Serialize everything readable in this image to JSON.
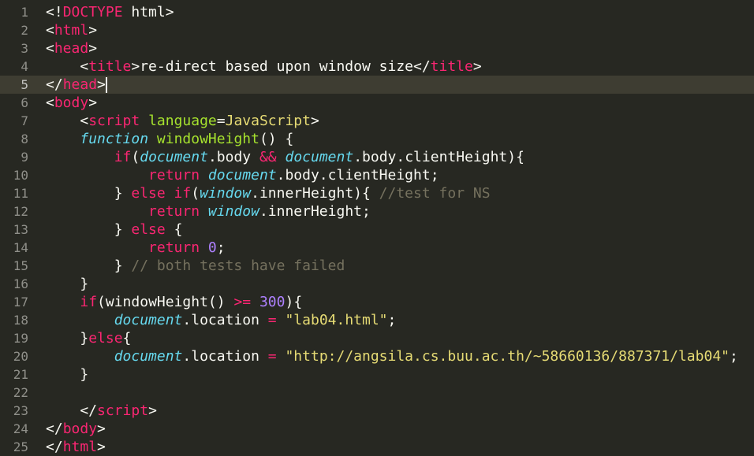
{
  "editor": {
    "theme": {
      "background": "#272822",
      "active_line": "#3e3d32",
      "tag": "#f92672",
      "attr": "#a6e22e",
      "string": "#e6db74",
      "support": "#66d9ef",
      "number": "#ae81ff",
      "comment": "#75715e"
    },
    "active_line_number": "5",
    "lines": [
      {
        "n": "1",
        "tokens": [
          [
            "t",
            "<!"
          ],
          [
            "tag",
            "DOCTYPE"
          ],
          [
            "t",
            " html>"
          ]
        ]
      },
      {
        "n": "2",
        "tokens": [
          [
            "t",
            "<"
          ],
          [
            "tag",
            "html"
          ],
          [
            "t",
            ">"
          ]
        ]
      },
      {
        "n": "3",
        "tokens": [
          [
            "t",
            "<"
          ],
          [
            "tag",
            "head"
          ],
          [
            "t",
            ">"
          ]
        ]
      },
      {
        "n": "4",
        "tokens": [
          [
            "t",
            "    <"
          ],
          [
            "tag",
            "title"
          ],
          [
            "t",
            ">re-direct based upon window size</"
          ],
          [
            "tag",
            "title"
          ],
          [
            "t",
            ">"
          ]
        ]
      },
      {
        "n": "5",
        "tokens": [
          [
            "t",
            "</"
          ],
          [
            "tag",
            "head"
          ],
          [
            "t",
            ">"
          ]
        ]
      },
      {
        "n": "6",
        "tokens": [
          [
            "t",
            "<"
          ],
          [
            "tag",
            "body"
          ],
          [
            "t",
            ">"
          ]
        ]
      },
      {
        "n": "7",
        "tokens": [
          [
            "t",
            "    <"
          ],
          [
            "tag",
            "script"
          ],
          [
            "t",
            " "
          ],
          [
            "attr",
            "language"
          ],
          [
            "t",
            "="
          ],
          [
            "str",
            "JavaScript"
          ],
          [
            "t",
            ">"
          ]
        ]
      },
      {
        "n": "8",
        "tokens": [
          [
            "t",
            "    "
          ],
          [
            "sf",
            "function"
          ],
          [
            "t",
            " "
          ],
          [
            "fn",
            "windowHeight"
          ],
          [
            "t",
            "() {"
          ]
        ]
      },
      {
        "n": "9",
        "tokens": [
          [
            "t",
            "        "
          ],
          [
            "kw",
            "if"
          ],
          [
            "t",
            "("
          ],
          [
            "sf",
            "document"
          ],
          [
            "t",
            ".body "
          ],
          [
            "op",
            "&&"
          ],
          [
            "t",
            " "
          ],
          [
            "sf",
            "document"
          ],
          [
            "t",
            ".body.clientHeight){"
          ]
        ]
      },
      {
        "n": "10",
        "tokens": [
          [
            "t",
            "            "
          ],
          [
            "kw",
            "return"
          ],
          [
            "t",
            " "
          ],
          [
            "sf",
            "document"
          ],
          [
            "t",
            ".body.clientHeight;"
          ]
        ]
      },
      {
        "n": "11",
        "tokens": [
          [
            "t",
            "        } "
          ],
          [
            "kw",
            "else if"
          ],
          [
            "t",
            "("
          ],
          [
            "sf",
            "window"
          ],
          [
            "t",
            ".innerHeight){ "
          ],
          [
            "cm",
            "//test for NS"
          ]
        ]
      },
      {
        "n": "12",
        "tokens": [
          [
            "t",
            "            "
          ],
          [
            "kw",
            "return"
          ],
          [
            "t",
            " "
          ],
          [
            "sf",
            "window"
          ],
          [
            "t",
            ".innerHeight;"
          ]
        ]
      },
      {
        "n": "13",
        "tokens": [
          [
            "t",
            "        } "
          ],
          [
            "kw",
            "else"
          ],
          [
            "t",
            " {"
          ]
        ]
      },
      {
        "n": "14",
        "tokens": [
          [
            "t",
            "            "
          ],
          [
            "kw",
            "return"
          ],
          [
            "t",
            " "
          ],
          [
            "num",
            "0"
          ],
          [
            "t",
            ";"
          ]
        ]
      },
      {
        "n": "15",
        "tokens": [
          [
            "t",
            "        } "
          ],
          [
            "cm",
            "// both tests have failed"
          ]
        ]
      },
      {
        "n": "16",
        "tokens": [
          [
            "t",
            "    }"
          ]
        ]
      },
      {
        "n": "17",
        "tokens": [
          [
            "t",
            "    "
          ],
          [
            "kw",
            "if"
          ],
          [
            "t",
            "(windowHeight() "
          ],
          [
            "op",
            ">="
          ],
          [
            "t",
            " "
          ],
          [
            "num",
            "300"
          ],
          [
            "t",
            "){"
          ]
        ]
      },
      {
        "n": "18",
        "tokens": [
          [
            "t",
            "        "
          ],
          [
            "sf",
            "document"
          ],
          [
            "t",
            ".location "
          ],
          [
            "op",
            "="
          ],
          [
            "t",
            " "
          ],
          [
            "str",
            "\"lab04.html\""
          ],
          [
            "t",
            ";"
          ]
        ]
      },
      {
        "n": "19",
        "tokens": [
          [
            "t",
            "    }"
          ],
          [
            "kw",
            "else"
          ],
          [
            "t",
            "{"
          ]
        ]
      },
      {
        "n": "20",
        "tokens": [
          [
            "t",
            "        "
          ],
          [
            "sf",
            "document"
          ],
          [
            "t",
            ".location "
          ],
          [
            "op",
            "="
          ],
          [
            "t",
            " "
          ],
          [
            "str",
            "\"http://angsila.cs.buu.ac.th/~58660136/887371/lab04\""
          ],
          [
            "t",
            ";"
          ]
        ]
      },
      {
        "n": "21",
        "tokens": [
          [
            "t",
            "    }"
          ]
        ]
      },
      {
        "n": "22",
        "tokens": []
      },
      {
        "n": "23",
        "tokens": [
          [
            "t",
            "    </"
          ],
          [
            "tag",
            "script"
          ],
          [
            "t",
            ">"
          ]
        ]
      },
      {
        "n": "24",
        "tokens": [
          [
            "t",
            "</"
          ],
          [
            "tag",
            "body"
          ],
          [
            "t",
            ">"
          ]
        ]
      },
      {
        "n": "25",
        "tokens": [
          [
            "t",
            "</"
          ],
          [
            "tag",
            "html"
          ],
          [
            "t",
            ">"
          ]
        ]
      }
    ]
  }
}
